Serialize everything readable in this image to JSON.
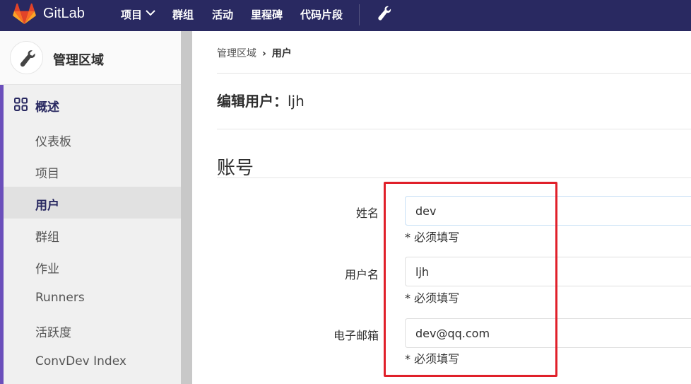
{
  "navbar": {
    "brand": "GitLab",
    "items": [
      "项目",
      "群组",
      "活动",
      "里程碑",
      "代码片段"
    ],
    "icons": [
      "gitlab-logo",
      "chevron-down-icon",
      "wrench-icon"
    ]
  },
  "sidebar": {
    "area_title": "管理区域",
    "overview_label": "概述",
    "items": [
      "仪表板",
      "项目",
      "用户",
      "群组",
      "作业",
      "Runners",
      "活跃度",
      "ConvDev Index"
    ],
    "active_item": "用户"
  },
  "breadcrumb": {
    "parent": "管理区域",
    "current": "用户"
  },
  "page": {
    "title_prefix": "编辑用户：",
    "title_name": "ljh",
    "section_title": "账号"
  },
  "form": {
    "fields": [
      {
        "label": "姓名",
        "value": "dev",
        "hint": "* 必须填写"
      },
      {
        "label": "用户名",
        "value": "ljh",
        "hint": "* 必须填写"
      },
      {
        "label": "电子邮箱",
        "value": "dev@qq.com",
        "hint": "* 必须填写"
      }
    ]
  },
  "colors": {
    "navbar_bg": "#292961",
    "active_accent": "#6b4fbb",
    "highlight_box": "#e0202a"
  }
}
